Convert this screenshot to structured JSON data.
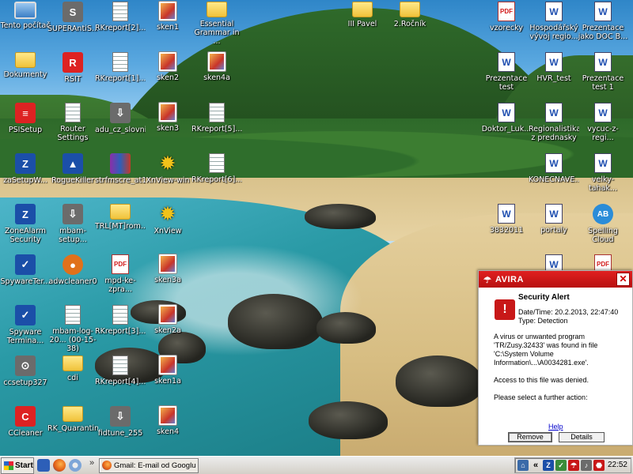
{
  "desktop": {
    "icons": [
      {
        "label": "Tento počítač",
        "icon": "computer-icon"
      },
      {
        "label": "SUPERAntiS...",
        "icon": "superantispyware-icon"
      },
      {
        "label": "RKreport[2]...",
        "icon": "text-document-icon"
      },
      {
        "label": "sken1",
        "icon": "image-icon"
      },
      {
        "label": "Essential Grammar in ...",
        "icon": "folder-icon"
      },
      {
        "label": "III Pavel",
        "icon": "folder-icon"
      },
      {
        "label": "2.Ročník",
        "icon": "folder-icon"
      },
      {
        "label": "vzorecky",
        "icon": "pdf-icon"
      },
      {
        "label": "Hospodářský vývoj regio...",
        "icon": "word-document-icon"
      },
      {
        "label": "Prezentace jako DOC B...",
        "icon": "word-document-icon"
      },
      {
        "label": "Dokumenty",
        "icon": "documents-folder-icon"
      },
      {
        "label": "RSIT",
        "icon": "rsit-icon"
      },
      {
        "label": "RKreport[1]...",
        "icon": "text-document-icon"
      },
      {
        "label": "sken2",
        "icon": "image-icon"
      },
      {
        "label": "sken4a",
        "icon": "image-icon"
      },
      {
        "label": "Prezentace test",
        "icon": "word-document-icon"
      },
      {
        "label": "HVR_test",
        "icon": "word-document-icon"
      },
      {
        "label": "Prezentace test 1",
        "icon": "word-document-icon"
      },
      {
        "label": "PSISetup",
        "icon": "psi-setup-icon"
      },
      {
        "label": "Router Settings",
        "icon": "text-document-icon"
      },
      {
        "label": "adu_cz_slovnik",
        "icon": "installer-icon"
      },
      {
        "label": "sken3",
        "icon": "image-icon"
      },
      {
        "label": "RKreport[5]...",
        "icon": "text-document-icon"
      },
      {
        "label": "Doktor_Luk...",
        "icon": "word-document-icon"
      },
      {
        "label": "Regionalistika z prednasky",
        "icon": "word-document-icon"
      },
      {
        "label": "vycuc-z-regi...",
        "icon": "word-document-icon"
      },
      {
        "label": "zaSetupW...",
        "icon": "zonealarm-setup-icon"
      },
      {
        "label": "RogueKiller",
        "icon": "roguekiller-icon"
      },
      {
        "label": "strfmscre_at1",
        "icon": "winrar-archive-icon"
      },
      {
        "label": "XnView-win",
        "icon": "xnview-installer-icon"
      },
      {
        "label": "RKreport[6]...",
        "icon": "text-document-icon"
      },
      {
        "label": "KONECNAVE...",
        "icon": "word-document-icon"
      },
      {
        "label": "velky-tahak...",
        "icon": "word-document-icon"
      },
      {
        "label": "ZoneAlarm Security",
        "icon": "zonealarm-icon"
      },
      {
        "label": "mbam-setup...",
        "icon": "installer-icon"
      },
      {
        "label": "TRL[MT]rom...",
        "icon": "folder-icon"
      },
      {
        "label": "XnView",
        "icon": "xnview-icon"
      },
      {
        "label": "3832011",
        "icon": "word-document-icon"
      },
      {
        "label": "portaly",
        "icon": "word-document-icon"
      },
      {
        "label": "Spelling Cloud",
        "icon": "spelling-cloud-icon"
      },
      {
        "label": "SpywareTer...",
        "icon": "spywareterminator-icon"
      },
      {
        "label": "adwcleaner0",
        "icon": "adwcleaner-icon"
      },
      {
        "label": "mpd-ke-zpra...",
        "icon": "pdf-icon"
      },
      {
        "label": "sken3a",
        "icon": "image-icon"
      },
      {
        "label": "Spyware Termina...",
        "icon": "spywareterminator-icon"
      },
      {
        "label": "mbam-log-20... (00-15-38)",
        "icon": "text-document-icon"
      },
      {
        "label": "RKreport[3]...",
        "icon": "text-document-icon"
      },
      {
        "label": "sken2a",
        "icon": "image-icon"
      },
      {
        "label": "ccsetup327",
        "icon": "ccleaner-setup-icon"
      },
      {
        "label": "cdi",
        "icon": "folder-icon"
      },
      {
        "label": "RKreport[4]...",
        "icon": "text-document-icon"
      },
      {
        "label": "sken1a",
        "icon": "image-icon"
      },
      {
        "label": "CCleaner",
        "icon": "ccleaner-icon"
      },
      {
        "label": "RK_Quarantine",
        "icon": "folder-icon"
      },
      {
        "label": "fidtune_255",
        "icon": "installer-icon"
      },
      {
        "label": "sken4",
        "icon": "image-icon"
      }
    ]
  },
  "alert": {
    "brand": "AVIRA",
    "title": "Security Alert",
    "datetime": "Date/Time: 20.2.2013, 22:47:40",
    "type": "Type: Detection",
    "message": "A virus or unwanted program 'TR/Zusy.32433' was found in file 'C:\\System Volume Information\\...\\A0034281.exe'.",
    "denied": "Access to this file was denied.",
    "prompt": "Please select a further action:",
    "help": "Help",
    "remove": "Remove",
    "details": "Details",
    "close_glyph": "✕",
    "warning_glyph": "!"
  },
  "taskbar": {
    "start": "Start",
    "quicklaunch_more": "»",
    "task_gmail": "Gmail: E-mail od Googlu -...",
    "tray_more": "«",
    "clock": "22:52"
  }
}
